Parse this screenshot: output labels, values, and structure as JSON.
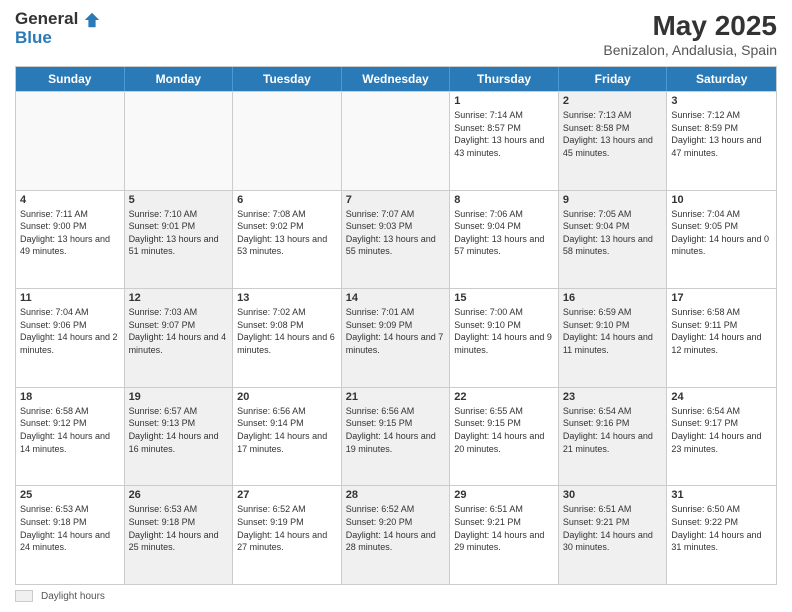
{
  "logo": {
    "general": "General",
    "blue": "Blue"
  },
  "title": {
    "month_year": "May 2025",
    "location": "Benizalon, Andalusia, Spain"
  },
  "header_days": [
    "Sunday",
    "Monday",
    "Tuesday",
    "Wednesday",
    "Thursday",
    "Friday",
    "Saturday"
  ],
  "weeks": [
    [
      {
        "day": "",
        "sunrise": "",
        "sunset": "",
        "daylight": "",
        "shaded": false,
        "empty": true
      },
      {
        "day": "",
        "sunrise": "",
        "sunset": "",
        "daylight": "",
        "shaded": false,
        "empty": true
      },
      {
        "day": "",
        "sunrise": "",
        "sunset": "",
        "daylight": "",
        "shaded": false,
        "empty": true
      },
      {
        "day": "",
        "sunrise": "",
        "sunset": "",
        "daylight": "",
        "shaded": false,
        "empty": true
      },
      {
        "day": "1",
        "sunrise": "Sunrise: 7:14 AM",
        "sunset": "Sunset: 8:57 PM",
        "daylight": "Daylight: 13 hours and 43 minutes.",
        "shaded": false,
        "empty": false
      },
      {
        "day": "2",
        "sunrise": "Sunrise: 7:13 AM",
        "sunset": "Sunset: 8:58 PM",
        "daylight": "Daylight: 13 hours and 45 minutes.",
        "shaded": true,
        "empty": false
      },
      {
        "day": "3",
        "sunrise": "Sunrise: 7:12 AM",
        "sunset": "Sunset: 8:59 PM",
        "daylight": "Daylight: 13 hours and 47 minutes.",
        "shaded": false,
        "empty": false
      }
    ],
    [
      {
        "day": "4",
        "sunrise": "Sunrise: 7:11 AM",
        "sunset": "Sunset: 9:00 PM",
        "daylight": "Daylight: 13 hours and 49 minutes.",
        "shaded": false,
        "empty": false
      },
      {
        "day": "5",
        "sunrise": "Sunrise: 7:10 AM",
        "sunset": "Sunset: 9:01 PM",
        "daylight": "Daylight: 13 hours and 51 minutes.",
        "shaded": true,
        "empty": false
      },
      {
        "day": "6",
        "sunrise": "Sunrise: 7:08 AM",
        "sunset": "Sunset: 9:02 PM",
        "daylight": "Daylight: 13 hours and 53 minutes.",
        "shaded": false,
        "empty": false
      },
      {
        "day": "7",
        "sunrise": "Sunrise: 7:07 AM",
        "sunset": "Sunset: 9:03 PM",
        "daylight": "Daylight: 13 hours and 55 minutes.",
        "shaded": true,
        "empty": false
      },
      {
        "day": "8",
        "sunrise": "Sunrise: 7:06 AM",
        "sunset": "Sunset: 9:04 PM",
        "daylight": "Daylight: 13 hours and 57 minutes.",
        "shaded": false,
        "empty": false
      },
      {
        "day": "9",
        "sunrise": "Sunrise: 7:05 AM",
        "sunset": "Sunset: 9:04 PM",
        "daylight": "Daylight: 13 hours and 58 minutes.",
        "shaded": true,
        "empty": false
      },
      {
        "day": "10",
        "sunrise": "Sunrise: 7:04 AM",
        "sunset": "Sunset: 9:05 PM",
        "daylight": "Daylight: 14 hours and 0 minutes.",
        "shaded": false,
        "empty": false
      }
    ],
    [
      {
        "day": "11",
        "sunrise": "Sunrise: 7:04 AM",
        "sunset": "Sunset: 9:06 PM",
        "daylight": "Daylight: 14 hours and 2 minutes.",
        "shaded": false,
        "empty": false
      },
      {
        "day": "12",
        "sunrise": "Sunrise: 7:03 AM",
        "sunset": "Sunset: 9:07 PM",
        "daylight": "Daylight: 14 hours and 4 minutes.",
        "shaded": true,
        "empty": false
      },
      {
        "day": "13",
        "sunrise": "Sunrise: 7:02 AM",
        "sunset": "Sunset: 9:08 PM",
        "daylight": "Daylight: 14 hours and 6 minutes.",
        "shaded": false,
        "empty": false
      },
      {
        "day": "14",
        "sunrise": "Sunrise: 7:01 AM",
        "sunset": "Sunset: 9:09 PM",
        "daylight": "Daylight: 14 hours and 7 minutes.",
        "shaded": true,
        "empty": false
      },
      {
        "day": "15",
        "sunrise": "Sunrise: 7:00 AM",
        "sunset": "Sunset: 9:10 PM",
        "daylight": "Daylight: 14 hours and 9 minutes.",
        "shaded": false,
        "empty": false
      },
      {
        "day": "16",
        "sunrise": "Sunrise: 6:59 AM",
        "sunset": "Sunset: 9:10 PM",
        "daylight": "Daylight: 14 hours and 11 minutes.",
        "shaded": true,
        "empty": false
      },
      {
        "day": "17",
        "sunrise": "Sunrise: 6:58 AM",
        "sunset": "Sunset: 9:11 PM",
        "daylight": "Daylight: 14 hours and 12 minutes.",
        "shaded": false,
        "empty": false
      }
    ],
    [
      {
        "day": "18",
        "sunrise": "Sunrise: 6:58 AM",
        "sunset": "Sunset: 9:12 PM",
        "daylight": "Daylight: 14 hours and 14 minutes.",
        "shaded": false,
        "empty": false
      },
      {
        "day": "19",
        "sunrise": "Sunrise: 6:57 AM",
        "sunset": "Sunset: 9:13 PM",
        "daylight": "Daylight: 14 hours and 16 minutes.",
        "shaded": true,
        "empty": false
      },
      {
        "day": "20",
        "sunrise": "Sunrise: 6:56 AM",
        "sunset": "Sunset: 9:14 PM",
        "daylight": "Daylight: 14 hours and 17 minutes.",
        "shaded": false,
        "empty": false
      },
      {
        "day": "21",
        "sunrise": "Sunrise: 6:56 AM",
        "sunset": "Sunset: 9:15 PM",
        "daylight": "Daylight: 14 hours and 19 minutes.",
        "shaded": true,
        "empty": false
      },
      {
        "day": "22",
        "sunrise": "Sunrise: 6:55 AM",
        "sunset": "Sunset: 9:15 PM",
        "daylight": "Daylight: 14 hours and 20 minutes.",
        "shaded": false,
        "empty": false
      },
      {
        "day": "23",
        "sunrise": "Sunrise: 6:54 AM",
        "sunset": "Sunset: 9:16 PM",
        "daylight": "Daylight: 14 hours and 21 minutes.",
        "shaded": true,
        "empty": false
      },
      {
        "day": "24",
        "sunrise": "Sunrise: 6:54 AM",
        "sunset": "Sunset: 9:17 PM",
        "daylight": "Daylight: 14 hours and 23 minutes.",
        "shaded": false,
        "empty": false
      }
    ],
    [
      {
        "day": "25",
        "sunrise": "Sunrise: 6:53 AM",
        "sunset": "Sunset: 9:18 PM",
        "daylight": "Daylight: 14 hours and 24 minutes.",
        "shaded": false,
        "empty": false
      },
      {
        "day": "26",
        "sunrise": "Sunrise: 6:53 AM",
        "sunset": "Sunset: 9:18 PM",
        "daylight": "Daylight: 14 hours and 25 minutes.",
        "shaded": true,
        "empty": false
      },
      {
        "day": "27",
        "sunrise": "Sunrise: 6:52 AM",
        "sunset": "Sunset: 9:19 PM",
        "daylight": "Daylight: 14 hours and 27 minutes.",
        "shaded": false,
        "empty": false
      },
      {
        "day": "28",
        "sunrise": "Sunrise: 6:52 AM",
        "sunset": "Sunset: 9:20 PM",
        "daylight": "Daylight: 14 hours and 28 minutes.",
        "shaded": true,
        "empty": false
      },
      {
        "day": "29",
        "sunrise": "Sunrise: 6:51 AM",
        "sunset": "Sunset: 9:21 PM",
        "daylight": "Daylight: 14 hours and 29 minutes.",
        "shaded": false,
        "empty": false
      },
      {
        "day": "30",
        "sunrise": "Sunrise: 6:51 AM",
        "sunset": "Sunset: 9:21 PM",
        "daylight": "Daylight: 14 hours and 30 minutes.",
        "shaded": true,
        "empty": false
      },
      {
        "day": "31",
        "sunrise": "Sunrise: 6:50 AM",
        "sunset": "Sunset: 9:22 PM",
        "daylight": "Daylight: 14 hours and 31 minutes.",
        "shaded": false,
        "empty": false
      }
    ]
  ],
  "footer": {
    "swatch_label": "Daylight hours"
  }
}
